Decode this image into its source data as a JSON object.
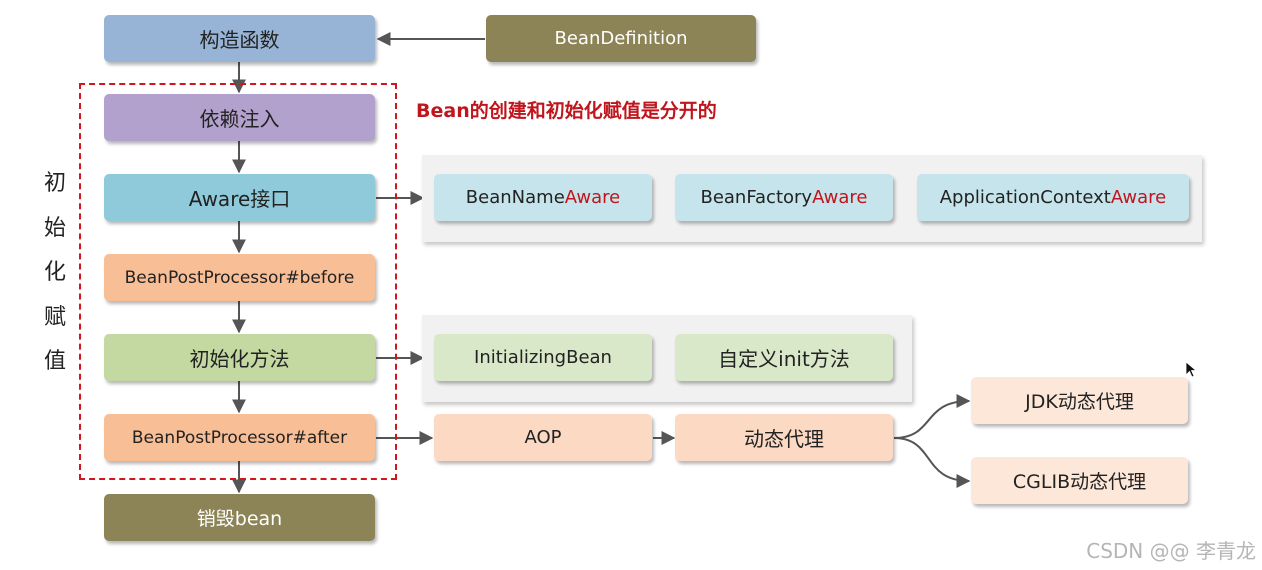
{
  "colors": {
    "blue": "#97b4d6",
    "olive": "#8c8456",
    "purple": "#b3a1cd",
    "cyan": "#8fcadb",
    "orange": "#f8be96",
    "green": "#c3d9a1",
    "light_cyan": "#c6e4ec",
    "light_green": "#d9e8c8",
    "peach": "#fbd9c3",
    "light_peach": "#fde7d9",
    "accent": "#c0151c",
    "arrow": "#555555"
  },
  "nodes": {
    "constructor": "构造函数",
    "bean_definition": "BeanDefinition",
    "dependency_injection": "依赖注入",
    "aware_interface": "Aware接口",
    "post_before": "BeanPostProcessor#before",
    "init_method": "初始化方法",
    "post_after": "BeanPostProcessor#after",
    "destroy_bean": "销毁bean",
    "bean_name_aware": {
      "prefix": "BeanName",
      "suffix": "Aware"
    },
    "bean_factory_aware": {
      "prefix": "BeanFactory",
      "suffix": "Aware"
    },
    "app_context_aware": {
      "prefix": "ApplicationContext",
      "suffix": "Aware"
    },
    "initializing_bean": "InitializingBean",
    "custom_init": "自定义init方法",
    "aop": "AOP",
    "dynamic_proxy": "动态代理",
    "jdk_proxy": "JDK动态代理",
    "cglib_proxy": "CGLIB动态代理"
  },
  "side_label": [
    "初",
    "始",
    "化",
    "赋",
    "值"
  ],
  "note": "Bean的创建和初始化赋值是分开的",
  "watermark": "CSDN @@ 李青龙"
}
